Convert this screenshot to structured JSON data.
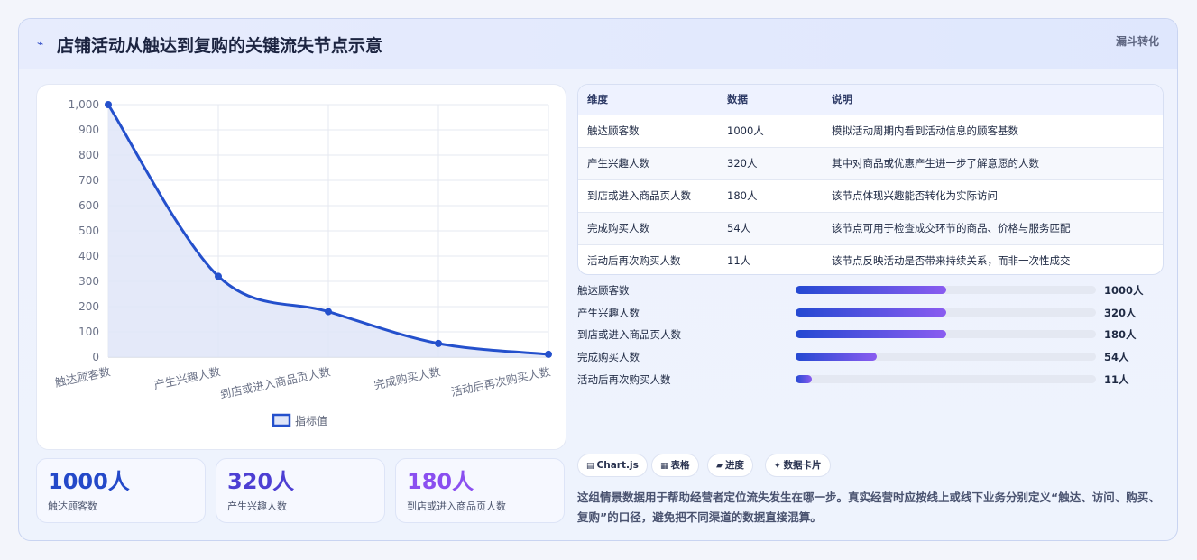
{
  "header": {
    "icon": "trend-line-icon",
    "title": "店铺活动从触达到复购的关键流失节点示意",
    "tag": "漏斗转化"
  },
  "chart_data": {
    "type": "line",
    "categories": [
      "触达顾客数",
      "产生兴趣人数",
      "到店或进入商品页人数",
      "完成购买人数",
      "活动后再次购买人数"
    ],
    "series": [
      {
        "name": "指标值",
        "values": [
          1000,
          320,
          180,
          54,
          11
        ]
      }
    ],
    "yticks": [
      "0",
      "100",
      "200",
      "300",
      "400",
      "500",
      "600",
      "700",
      "800",
      "900",
      "1,000"
    ],
    "ylim": [
      0,
      1000
    ],
    "grid": true,
    "legend": "bottom",
    "colors": {
      "line": "#2450cc",
      "fill": "#dfe5f8"
    }
  },
  "stats": [
    {
      "value": "1000人",
      "label": "触达顾客数",
      "color": "#2449c9"
    },
    {
      "value": "320人",
      "label": "产生兴趣人数",
      "color": "#4d3fd3"
    },
    {
      "value": "180人",
      "label": "到店或进入商品页人数",
      "color": "#8a4ff0"
    }
  ],
  "table": {
    "headers": [
      "维度",
      "数据",
      "说明"
    ],
    "rows": [
      [
        "触达顾客数",
        "1000人",
        "模拟活动周期内看到活动信息的顾客基数"
      ],
      [
        "产生兴趣人数",
        "320人",
        "其中对商品或优惠产生进一步了解意愿的人数"
      ],
      [
        "到店或进入商品页人数",
        "180人",
        "该节点体现兴趣能否转化为实际访问"
      ],
      [
        "完成购买人数",
        "54人",
        "该节点可用于检查成交环节的商品、价格与服务匹配"
      ],
      [
        "活动后再次购买人数",
        "11人",
        "该节点反映活动是否带来持续关系，而非一次性成交"
      ]
    ]
  },
  "progress": [
    {
      "label": "触达顾客数",
      "value": "1000人",
      "fraction": 0.5
    },
    {
      "label": "产生兴趣人数",
      "value": "320人",
      "fraction": 0.5
    },
    {
      "label": "到店或进入商品页人数",
      "value": "180人",
      "fraction": 0.5
    },
    {
      "label": "完成购买人数",
      "value": "54人",
      "fraction": 0.27
    },
    {
      "label": "活动后再次购买人数",
      "value": "11人",
      "fraction": 0.055
    }
  ],
  "pills": [
    {
      "icon": "▤",
      "label": "Chart.js"
    },
    {
      "icon": "▦",
      "label": "表格"
    },
    {
      "icon": "▰",
      "label": "进度"
    },
    {
      "icon": "✦",
      "label": "数据卡片"
    }
  ],
  "note": "这组情景数据用于帮助经营者定位流失发生在哪一步。真实经营时应按线上或线下业务分别定义“触达、访问、购买、复购”的口径，避免把不同渠道的数据直接混算。"
}
